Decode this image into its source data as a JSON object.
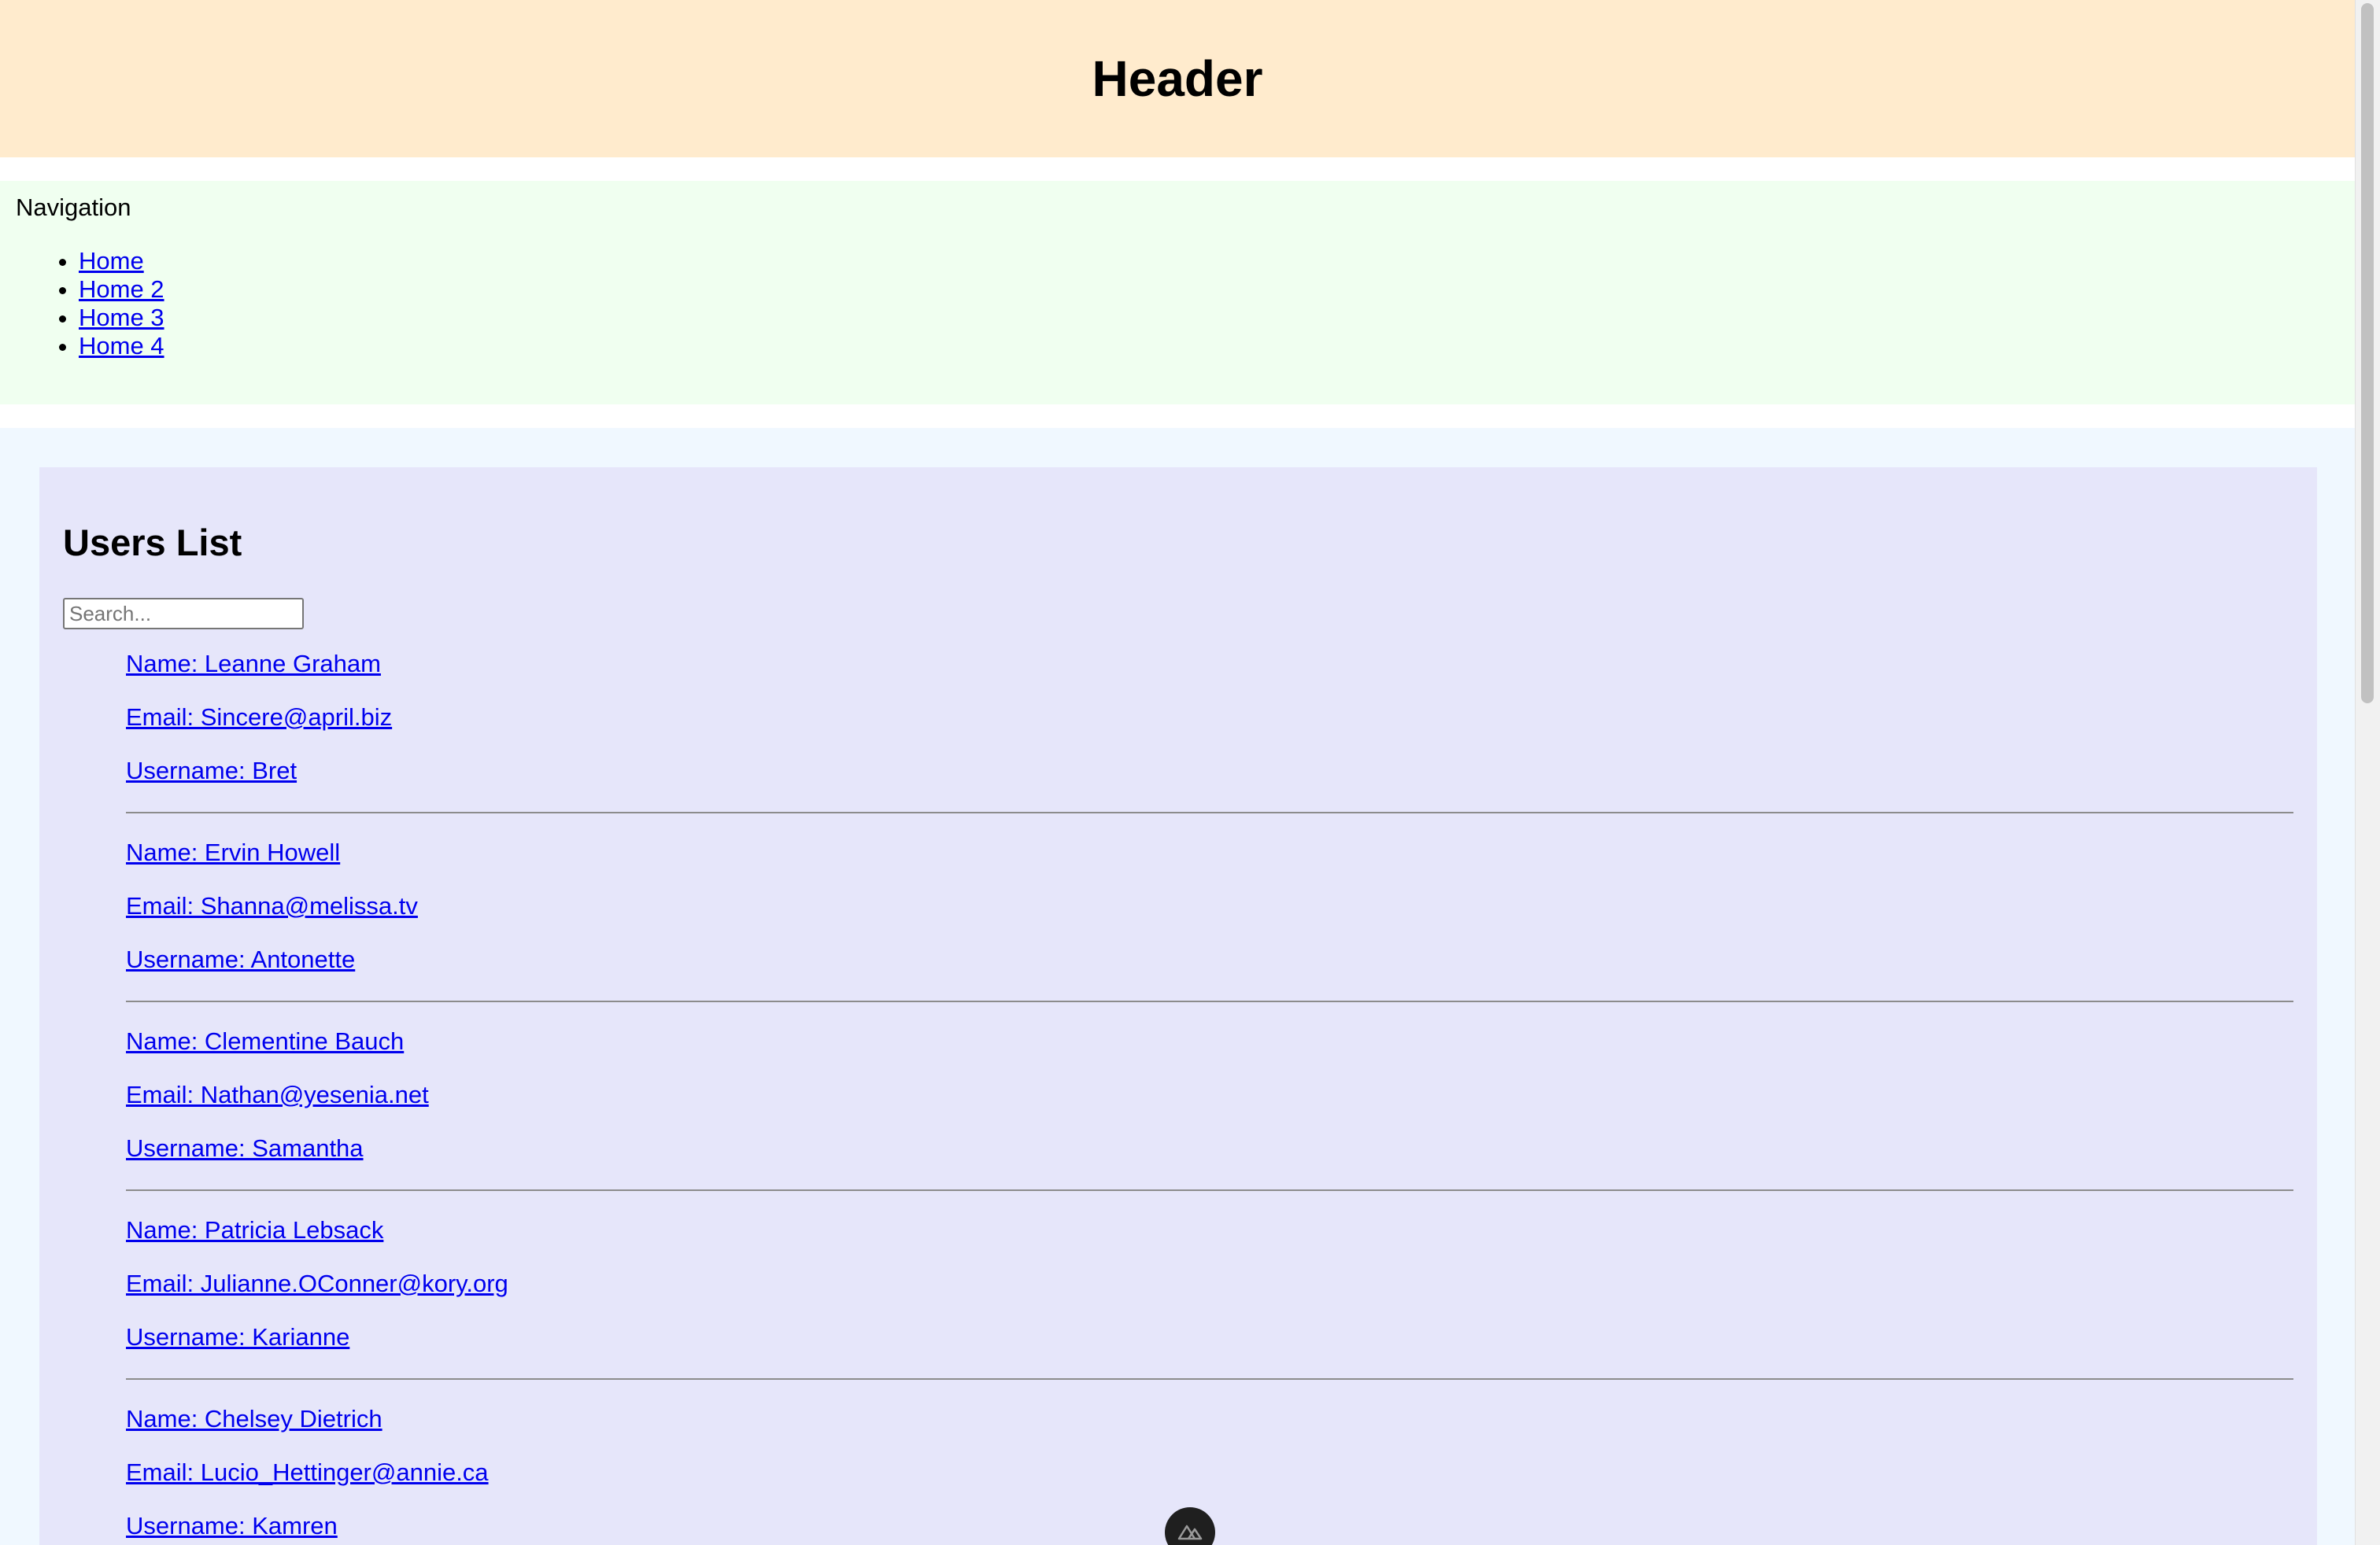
{
  "header": {
    "title": "Header"
  },
  "nav": {
    "title": "Navigation",
    "links": [
      {
        "label": "Home"
      },
      {
        "label": "Home 2"
      },
      {
        "label": "Home 3"
      },
      {
        "label": "Home 4"
      }
    ]
  },
  "main": {
    "heading": "Users List",
    "search": {
      "placeholder": "Search...",
      "value": ""
    },
    "users": [
      {
        "name": "Name: Leanne Graham",
        "email": "Email: Sincere@april.biz",
        "username": "Username: Bret"
      },
      {
        "name": "Name: Ervin Howell",
        "email": "Email: Shanna@melissa.tv",
        "username": "Username: Antonette"
      },
      {
        "name": "Name: Clementine Bauch",
        "email": "Email: Nathan@yesenia.net",
        "username": "Username: Samantha"
      },
      {
        "name": "Name: Patricia Lebsack",
        "email": "Email: Julianne.OConner@kory.org",
        "username": "Username: Karianne"
      },
      {
        "name": "Name: Chelsey Dietrich",
        "email": "Email: Lucio_Hettinger@annie.ca",
        "username": "Username: Kamren"
      }
    ]
  },
  "devtools": {
    "icon": "nuxt-devtools-icon"
  },
  "colors": {
    "header_bg": "#ffebcd",
    "nav_bg": "#f0fff0",
    "main_bg": "#f0f8ff",
    "panel_bg": "#e6e6fa",
    "link": "#0000ee"
  }
}
